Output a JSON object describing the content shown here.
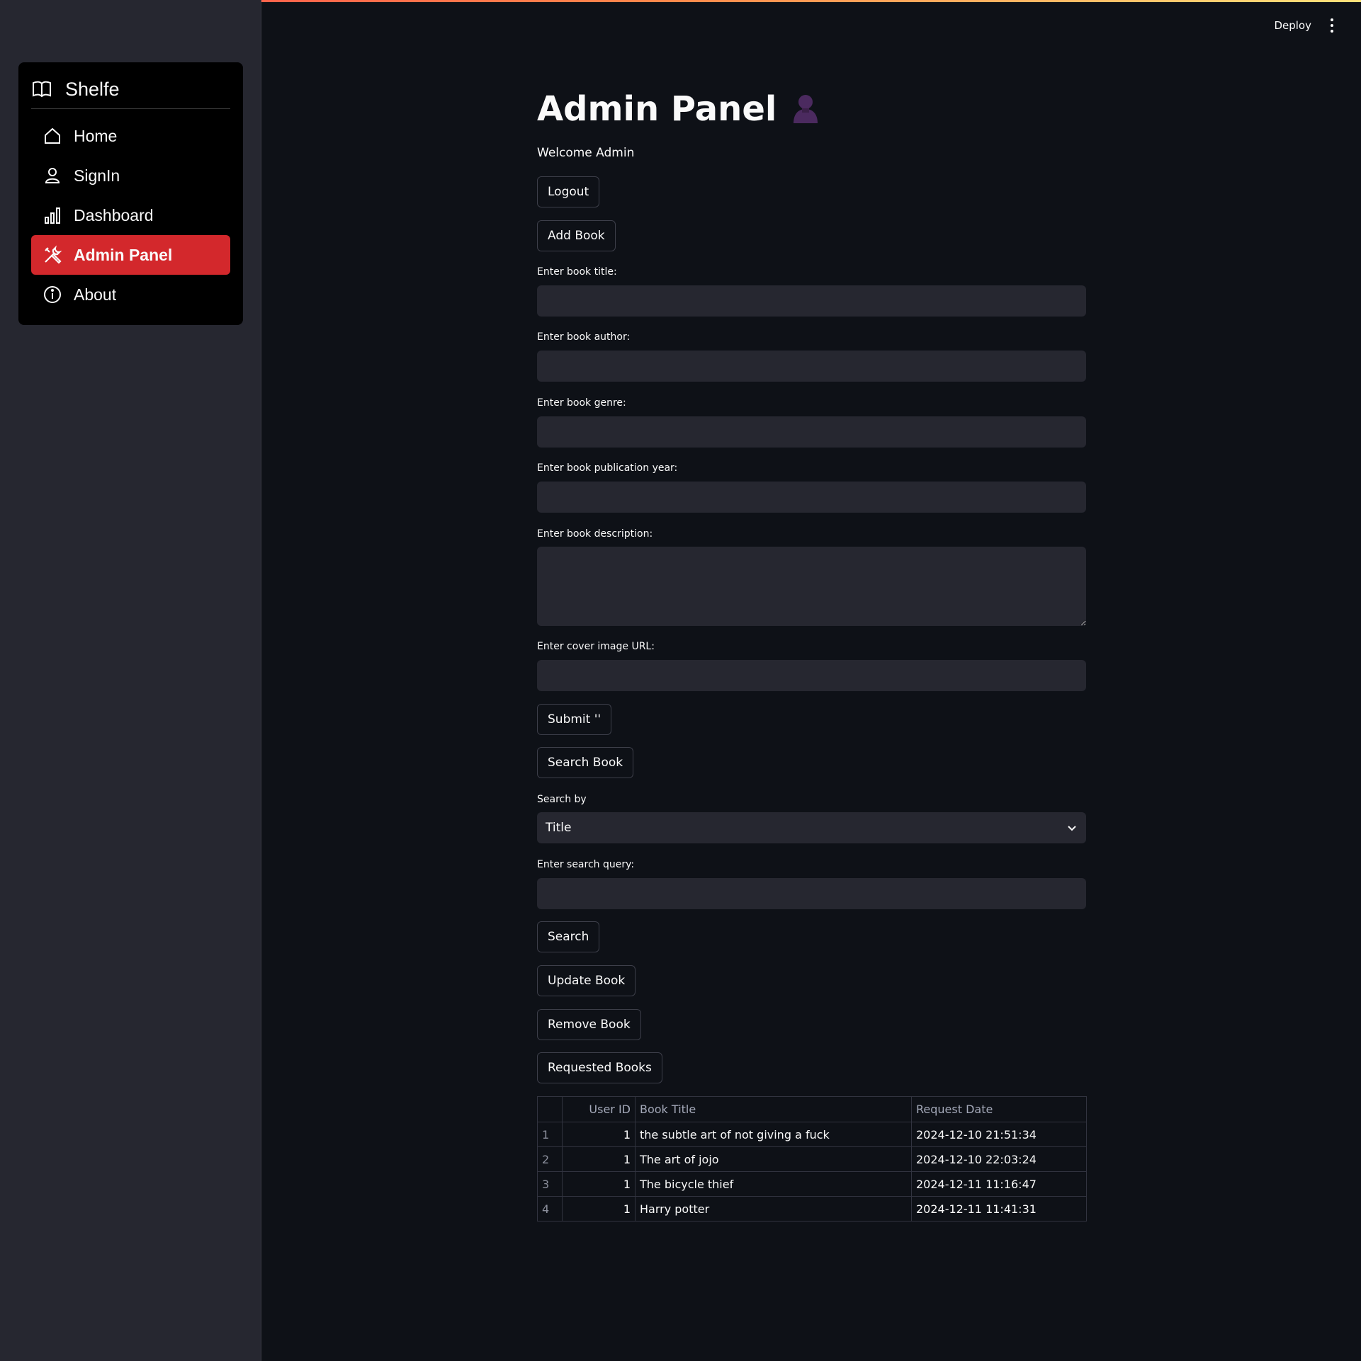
{
  "app": {
    "brand": "Shelfe",
    "accent_color": "#d3282c"
  },
  "sidebar": {
    "items": [
      {
        "label": "Home",
        "icon": "home-icon",
        "active": false
      },
      {
        "label": "SignIn",
        "icon": "person-icon",
        "active": false
      },
      {
        "label": "Dashboard",
        "icon": "bar-chart-icon",
        "active": false
      },
      {
        "label": "Admin Panel",
        "icon": "tools-icon",
        "active": true
      },
      {
        "label": "About",
        "icon": "info-icon",
        "active": false
      }
    ]
  },
  "header": {
    "deploy_label": "Deploy"
  },
  "main": {
    "title": "Admin Panel",
    "welcome": "Welcome Admin",
    "buttons": {
      "logout": "Logout",
      "add_book": "Add Book",
      "submit": "Submit ''",
      "search_book": "Search Book",
      "search": "Search",
      "update_book": "Update Book",
      "remove_book": "Remove Book",
      "requested_books": "Requested Books"
    },
    "form": {
      "title_label": "Enter book title:",
      "title_value": "",
      "author_label": "Enter book author:",
      "author_value": "",
      "genre_label": "Enter book genre:",
      "genre_value": "",
      "year_label": "Enter book publication year:",
      "year_value": "",
      "description_label": "Enter book description:",
      "description_value": "",
      "cover_label": "Enter cover image URL:",
      "cover_value": ""
    },
    "search": {
      "by_label": "Search by",
      "by_value": "Title",
      "query_label": "Enter search query:",
      "query_value": ""
    },
    "requests_table": {
      "columns": [
        "",
        "User ID",
        "Book Title",
        "Request Date"
      ],
      "rows": [
        {
          "index": "1",
          "user_id": "1",
          "book_title": "the subtle art of not giving a fuck",
          "request_date": "2024-12-10 21:51:34"
        },
        {
          "index": "2",
          "user_id": "1",
          "book_title": "The art of jojo",
          "request_date": "2024-12-10 22:03:24"
        },
        {
          "index": "3",
          "user_id": "1",
          "book_title": "The bicycle thief",
          "request_date": "2024-12-11 11:16:47"
        },
        {
          "index": "4",
          "user_id": "1",
          "book_title": "Harry potter",
          "request_date": "2024-12-11 11:41:31"
        }
      ]
    }
  }
}
